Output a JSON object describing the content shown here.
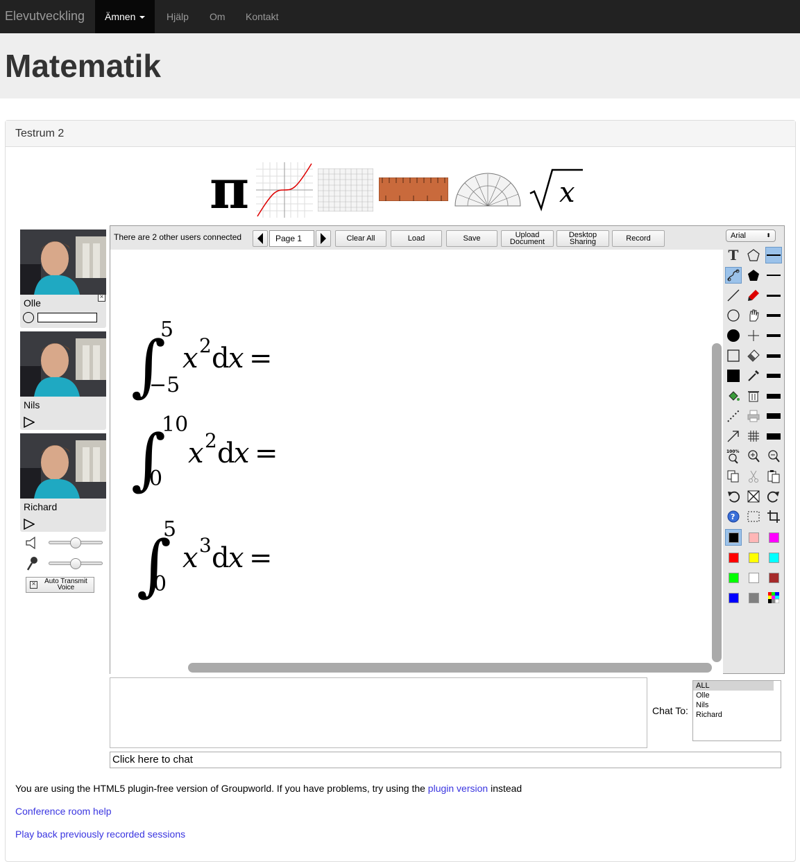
{
  "nav": {
    "brand": "Elevutveckling",
    "items": [
      "Ämnen",
      "Hjälp",
      "Om",
      "Kontakt"
    ]
  },
  "page_title": "Matematik",
  "panel_title": "Testrum 2",
  "users": [
    {
      "name": "Olle"
    },
    {
      "name": "Nils"
    },
    {
      "name": "Richard"
    }
  ],
  "auto_transmit": "Auto Transmit Voice",
  "toolbar": {
    "status": "There are 2 other users connected",
    "page": "Page 1",
    "clear_all": "Clear All",
    "load": "Load",
    "save": "Save",
    "upload_document": [
      "Upload",
      "Document"
    ],
    "desktop_sharing": [
      "Desktop",
      "Sharing"
    ],
    "record": "Record",
    "font": "Arial"
  },
  "math": [
    {
      "lower": "−5",
      "upper": "5",
      "power": "2"
    },
    {
      "lower": "0",
      "upper": "10",
      "power": "2"
    },
    {
      "lower": "0",
      "upper": "5",
      "power": "3"
    }
  ],
  "chat": {
    "label": "Chat To:",
    "recipients": [
      "ALL",
      "Olle",
      "Nils",
      "Richard"
    ],
    "input_placeholder": "Click here to chat"
  },
  "footer": {
    "html5_text_before": "You are using the HTML5 plugin-free version of Groupworld. If you have problems, try using the",
    "plugin_link": "plugin version",
    "html5_text_after": "instead",
    "help_link": "Conference room help",
    "playback_link": "Play back previously recorded sessions"
  },
  "palette": [
    "#000000",
    "#ffb6b6",
    "#ff00ff",
    "#ff0000",
    "#ffff00",
    "#00ffff",
    "#00ff00",
    "#ffffff",
    "#a52a2a",
    "#0000ff",
    "#808080"
  ]
}
